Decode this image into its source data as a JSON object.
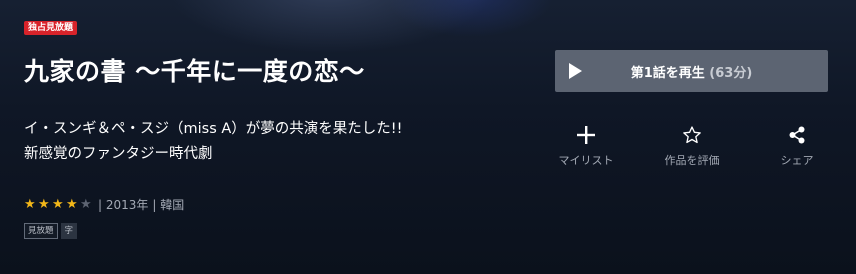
{
  "header": {
    "badge": "独占見放題",
    "title": "九家の書 〜千年に一度の恋〜"
  },
  "description": {
    "line1": "イ・スンギ＆ペ・スジ（miss A）が夢の共演を果たした!!",
    "line2": "新感覚のファンタジー時代劇"
  },
  "meta": {
    "rating": 4,
    "rating_max": 5,
    "year_text": "| 2013年",
    "country_text": "| 韓国"
  },
  "tags": [
    "見放題",
    "字"
  ],
  "play": {
    "label": "第1話を再生",
    "duration": "(63分)"
  },
  "actions": {
    "mylist": "マイリスト",
    "rate": "作品を評価",
    "share": "シェア"
  },
  "colors": {
    "badge": "#d8232a",
    "star_on": "#f2b719",
    "star_off": "#5d6472",
    "play_button": "#5c6472",
    "background": "#0e1623"
  },
  "icons": {
    "play": "play-icon",
    "mylist": "plus-icon",
    "rate": "star-outline-icon",
    "share": "share-icon"
  }
}
